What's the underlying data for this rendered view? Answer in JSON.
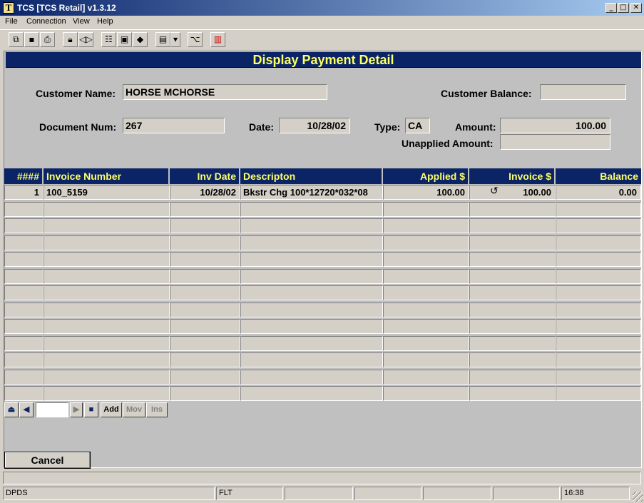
{
  "window": {
    "title": "TCS [TCS Retail]  v1.3.12",
    "icon_glyph": "T",
    "controls": {
      "minimize": "_",
      "maximize": "□",
      "close": "✕"
    }
  },
  "menu": [
    "File",
    "Connection",
    "View",
    "Help"
  ],
  "toolbar": {
    "icons": [
      "copy-icon",
      "save-icon",
      "print-icon",
      "lock-icon",
      "audio-icon",
      "properties-icon",
      "monitor-icon",
      "book-icon",
      "window-list-icon",
      "dropdown-arrow-icon",
      "tree-icon",
      "chart-icon"
    ]
  },
  "page": {
    "title": "Display Payment Detail",
    "title_color": "#ffff66",
    "header_bg": "#0a2465"
  },
  "form": {
    "customer_name_label": "Customer Name:",
    "customer_name": "HORSE MCHORSE",
    "customer_balance_label": "Customer Balance:",
    "customer_balance": "",
    "document_num_label": "Document Num:",
    "document_num": "267",
    "date_label": "Date:",
    "date": "10/28/02",
    "type_label": "Type:",
    "type": "CA",
    "amount_label": "Amount:",
    "amount": "100.00",
    "unapplied_label": "Unapplied Amount:",
    "unapplied": ""
  },
  "grid": {
    "columns": [
      "####",
      "Invoice Number",
      "Inv Date",
      "Descripton",
      "Applied $",
      "Invoice $",
      "Balance"
    ],
    "rows": [
      {
        "num": "1",
        "invoice": "100_5159",
        "inv_date": "10/28/02",
        "desc": "Bkstr Chg 100*12720*032*08",
        "applied": "100.00",
        "invoice_amt": "100.00",
        "balance": "0.00"
      }
    ],
    "empty_rows": 12
  },
  "navigator": {
    "first": "⏏",
    "prev": "◀",
    "next": "▶",
    "stop": "■",
    "add": "Add",
    "mov": "Mov",
    "ins": "Ins"
  },
  "buttons": {
    "cancel": "Cancel"
  },
  "status": {
    "left": "DPDS",
    "mode": "FLT",
    "time": "16:38"
  }
}
